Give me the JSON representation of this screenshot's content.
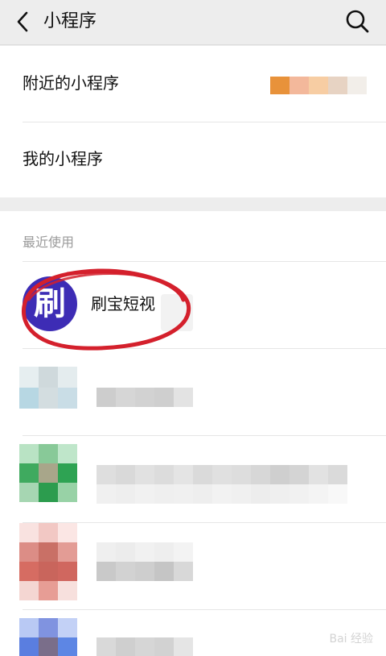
{
  "header": {
    "title": "小程序",
    "back_icon": "chevron-left-icon",
    "search_icon": "search-icon"
  },
  "menu": {
    "nearby_label": "附近的小程序",
    "mine_label": "我的小程序"
  },
  "recent": {
    "section_title": "最近使用",
    "items": [
      {
        "name": "刷宝短视",
        "icon_glyph": "刷",
        "icon_color": "#3d2cb5"
      }
    ]
  },
  "annotation": {
    "circle_color": "#d4202c"
  },
  "watermark": {
    "text": "Bai 经验"
  }
}
